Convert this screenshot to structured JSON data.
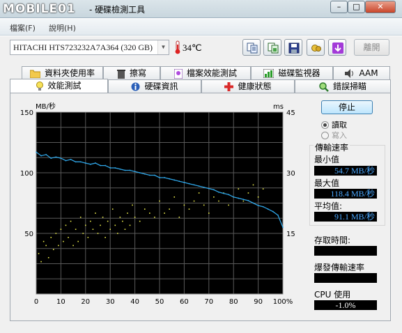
{
  "window": {
    "logo": "MOBILE01",
    "title": "- 硬碟檢測工具",
    "min_glyph": "–",
    "max_glyph": "□",
    "close_glyph": "✕"
  },
  "menu": [
    {
      "label": "檔案(F)"
    },
    {
      "label": "說明(H)"
    }
  ],
  "toolbar": {
    "drive": "HITACHI HTS723232A7A364 (320 GB)",
    "temperature": "34℃",
    "buttons": [
      "copy-text-icon",
      "copy-screenshot-icon",
      "save-icon",
      "options-icon",
      "download-icon"
    ],
    "exit_label": "離開"
  },
  "tabs_top": [
    {
      "label": "資料夾使用率",
      "icon": "folder-icon"
    },
    {
      "label": "擦寫",
      "icon": "trash-icon"
    },
    {
      "label": "檔案效能測試",
      "icon": "file-benchmark-icon"
    },
    {
      "label": "磁碟監視器",
      "icon": "bar-chart-icon"
    },
    {
      "label": "AAM",
      "icon": "speaker-icon"
    }
  ],
  "tabs_bottom": [
    {
      "label": "效能測試",
      "icon": "lightbulb-icon",
      "active": true
    },
    {
      "label": "硬碟資訊",
      "icon": "info-icon"
    },
    {
      "label": "健康狀態",
      "icon": "health-cross-icon"
    },
    {
      "label": "錯誤掃瞄",
      "icon": "magnifier-icon"
    }
  ],
  "controls": {
    "stop_label": "停止",
    "read_label": "讀取",
    "write_label": "寫入",
    "read_selected": true
  },
  "stats": {
    "transfer_rate_label": "傳輸速率",
    "min_label": "最小值",
    "min_value": "54.7 MB/秒",
    "max_label": "最大值",
    "max_value": "118.4 MB/秒",
    "avg_label": "平均值:",
    "avg_value": "91.1 MB/秒",
    "access_time_label": "存取時間:",
    "access_time_value": "",
    "burst_label": "爆發傳輸速率",
    "burst_value": "",
    "cpu_label": "CPU 使用",
    "cpu_value": "-1.0%"
  },
  "colors": {
    "plot_bg": "#000000",
    "grid": "#5a5a5a",
    "transfer_line": "#2fa6e8",
    "access_dots": "#e8e84a"
  },
  "chart_data": {
    "type": "line",
    "xlabel": "",
    "ylabel_left": "MB/秒",
    "ylabel_right": "ms",
    "xlim": [
      0,
      100
    ],
    "ylim_left": [
      0,
      150
    ],
    "ylim_right": [
      0,
      45
    ],
    "x_ticks": [
      "0",
      "10",
      "20",
      "30",
      "40",
      "50",
      "60",
      "70",
      "80",
      "90",
      "100%"
    ],
    "y_ticks_left": [
      "150",
      "100",
      "50"
    ],
    "y_ticks_right": [
      "45",
      "30",
      "15"
    ],
    "grid": true,
    "series": [
      {
        "kind": "line",
        "axis": "left",
        "x": [
          0,
          2,
          4,
          6,
          8,
          10,
          12,
          14,
          16,
          18,
          20,
          22,
          24,
          26,
          28,
          30,
          32,
          34,
          36,
          38,
          40,
          42,
          44,
          46,
          48,
          50,
          52,
          54,
          56,
          58,
          60,
          62,
          64,
          66,
          68,
          70,
          72,
          74,
          76,
          78,
          80,
          82,
          84,
          86,
          88,
          90,
          92,
          94,
          96,
          98,
          100
        ],
        "values": [
          117,
          114,
          115,
          112,
          113,
          112,
          110,
          111,
          109,
          109,
          108,
          107,
          108,
          106,
          106,
          104,
          104,
          103,
          102,
          102,
          101,
          100,
          99,
          98,
          98,
          96,
          96,
          95,
          94,
          93,
          92,
          91,
          90,
          89,
          88,
          87,
          86,
          84,
          83,
          82,
          80,
          79,
          78,
          77,
          75,
          73,
          72,
          70,
          68,
          65,
          55
        ]
      },
      {
        "kind": "scatter",
        "axis": "right",
        "x": [
          1,
          2,
          3,
          4,
          5,
          6,
          7,
          8,
          9,
          10,
          11,
          12,
          13,
          14,
          15,
          16,
          17,
          18,
          19,
          20,
          21,
          22,
          23,
          24,
          25,
          26,
          27,
          28,
          29,
          30,
          31,
          32,
          33,
          34,
          35,
          36,
          37,
          38,
          39,
          40,
          42,
          44,
          46,
          48,
          50,
          52,
          54,
          56,
          58,
          60,
          62,
          64,
          66,
          68,
          70,
          72,
          74,
          76,
          78,
          80,
          82,
          84,
          86,
          88,
          90,
          92
        ],
        "values": [
          10,
          8,
          13,
          12,
          9,
          14,
          11,
          15,
          12,
          16,
          13,
          17,
          14,
          18,
          12,
          16,
          13,
          19,
          15,
          17,
          14,
          18,
          16,
          20,
          15,
          17,
          19,
          14,
          18,
          16,
          21,
          17,
          15,
          19,
          18,
          16,
          20,
          17,
          22,
          19,
          18,
          21,
          20,
          19,
          23,
          20,
          21,
          24,
          19,
          22,
          21,
          23,
          25,
          22,
          20,
          24,
          23,
          25,
          22,
          24,
          26,
          23,
          25,
          27,
          24,
          26
        ]
      }
    ]
  }
}
